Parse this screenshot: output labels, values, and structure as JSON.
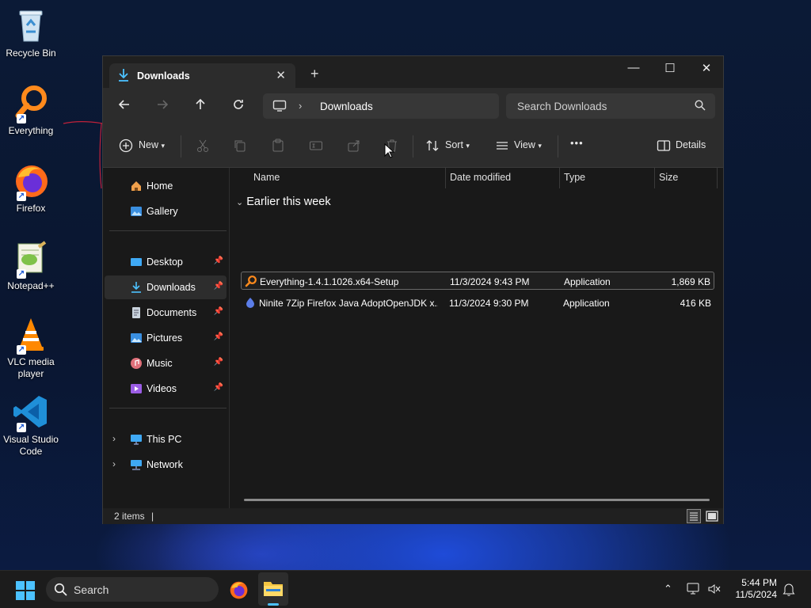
{
  "desktop": {
    "icons": [
      {
        "label": "Recycle Bin"
      },
      {
        "label": "Everything"
      },
      {
        "label": "Firefox"
      },
      {
        "label": "Notepad++"
      },
      {
        "label": "VLC media player"
      },
      {
        "label": "Visual Studio Code"
      }
    ]
  },
  "window": {
    "tab": {
      "title": "Downloads",
      "close": "✕"
    },
    "newtab": "+",
    "controls": {
      "minimize": "—",
      "maximize": "☐",
      "close": "✕"
    },
    "address": {
      "crumb": "Downloads",
      "chevron": "›"
    },
    "search": {
      "placeholder": "Search Downloads"
    },
    "toolbar": {
      "new_label": "New",
      "sort_label": "Sort",
      "view_label": "View",
      "more_label": "•••",
      "details_label": "Details"
    },
    "sidebar": {
      "items": [
        {
          "label": "Home"
        },
        {
          "label": "Gallery"
        },
        {
          "label": "Desktop"
        },
        {
          "label": "Downloads"
        },
        {
          "label": "Documents"
        },
        {
          "label": "Pictures"
        },
        {
          "label": "Music"
        },
        {
          "label": "Videos"
        },
        {
          "label": "This PC"
        },
        {
          "label": "Network"
        }
      ]
    },
    "columns": {
      "name": "Name",
      "date": "Date modified",
      "type": "Type",
      "size": "Size"
    },
    "group_label": "Earlier this week",
    "files": [
      {
        "name": "Everything-1.4.1.1026.x64-Setup",
        "date": "11/3/2024 9:43 PM",
        "type": "Application",
        "size": "1,869 KB"
      },
      {
        "name": "Ninite 7Zip Firefox Java AdoptOpenJDK x...",
        "date": "11/3/2024 9:30 PM",
        "type": "Application",
        "size": "416 KB"
      }
    ],
    "status": {
      "count": "2 items",
      "cursor": "|"
    }
  },
  "taskbar": {
    "search_placeholder": "Search",
    "time": "5:44 PM",
    "date": "11/5/2024"
  },
  "colors": {
    "accent": "#4cc2ff",
    "window_bg": "#191919",
    "chrome": "#2c2c2c"
  }
}
